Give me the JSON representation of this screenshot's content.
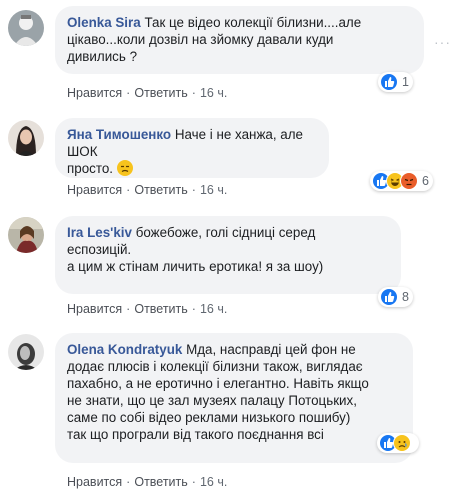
{
  "comments": [
    {
      "author": "Olenka Sira",
      "lines": [
        "Так це відео колекції білизни....але",
        "цікаво...коли дозвіл на зйомку давали куди",
        "дивились ?"
      ],
      "reaction_count": "1",
      "reactions": [
        "like-icon"
      ],
      "like_label": "Нравится",
      "reply_label": "Ответить",
      "time": "16 ч."
    },
    {
      "author": "Яна Тимошенко",
      "lines": [
        "Наче і не ханжа, але ШОК",
        "просто."
      ],
      "reaction_count": "6",
      "reactions": [
        "like-icon",
        "haha-icon",
        "angry-icon"
      ],
      "like_label": "Нравится",
      "reply_label": "Ответить",
      "time": "16 ч."
    },
    {
      "author": "Ira Les'kiv",
      "lines": [
        "божебоже, голі сідниці серед",
        "еспозицій.",
        "а цим ж стінам личить еротика! я за шоу)"
      ],
      "reaction_count": "8",
      "reactions": [
        "like-icon"
      ],
      "like_label": "Нравится",
      "reply_label": "Ответить",
      "time": "16 ч."
    },
    {
      "author": "Olena Kondratyuk",
      "lines": [
        "Мда, насправді цей фон не",
        "додає плюсів і колекції білизни також, виглядає",
        "пахабно, а не еротично і елегантно. Навіть якщо",
        "не знати, що це зал музеях палацу Потоцьких,",
        "саме по собі відео реклами низького пошибу)",
        "так що програли від такого поєднання всі"
      ],
      "reaction_count": "",
      "reactions": [
        "like-icon",
        "sad-icon"
      ],
      "like_label": "Нравится",
      "reply_label": "Ответить",
      "time": "16 ч."
    }
  ],
  "colors": {
    "author": "#385898",
    "bubble": "#f2f3f5",
    "like": "#1877f2"
  }
}
